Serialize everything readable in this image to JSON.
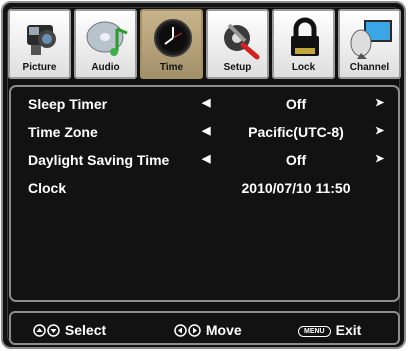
{
  "tabs": [
    {
      "label": "Picture",
      "icon": "camcorder-icon"
    },
    {
      "label": "Audio",
      "icon": "music-disc-icon"
    },
    {
      "label": "Time",
      "icon": "clock-icon",
      "active": true
    },
    {
      "label": "Setup",
      "icon": "wrench-gear-icon"
    },
    {
      "label": "Lock",
      "icon": "padlock-icon"
    },
    {
      "label": "Channel",
      "icon": "satellite-dish-icon"
    }
  ],
  "settings": {
    "sleep_timer": {
      "label": "Sleep Timer",
      "value": "Off"
    },
    "time_zone": {
      "label": "Time Zone",
      "value": "Pacific(UTC-8)"
    },
    "daylight_saving": {
      "label": "Daylight Saving Time",
      "value": "Off"
    },
    "clock": {
      "label": "Clock",
      "value": "2010/07/10  11:50"
    }
  },
  "footer": {
    "select_label": "Select",
    "move_label": "Move",
    "menu_key": "MENU",
    "exit_label": "Exit"
  },
  "colors": {
    "active_tab": "#b7a47b",
    "background": "#111111",
    "text": "#ffffff"
  }
}
